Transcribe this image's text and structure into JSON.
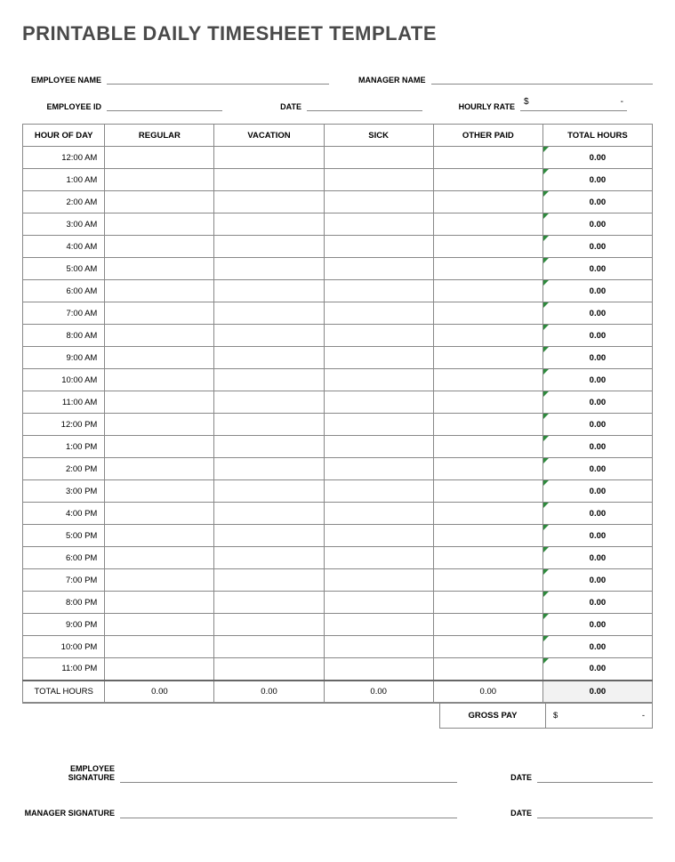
{
  "title": "PRINTABLE DAILY TIMESHEET TEMPLATE",
  "meta": {
    "employee_name_label": "EMPLOYEE NAME",
    "employee_name_value": "",
    "manager_name_label": "MANAGER NAME",
    "manager_name_value": "",
    "employee_id_label": "EMPLOYEE ID",
    "employee_id_value": "",
    "date_label": "DATE",
    "date_value": "",
    "hourly_rate_label": "HOURLY RATE",
    "hourly_rate_currency": "$",
    "hourly_rate_value": "-"
  },
  "columns": {
    "hour": "HOUR OF DAY",
    "regular": "REGULAR",
    "vacation": "VACATION",
    "sick": "SICK",
    "other": "OTHER PAID",
    "total": "TOTAL HOURS"
  },
  "rows": [
    {
      "hour": "12:00 AM",
      "regular": "",
      "vacation": "",
      "sick": "",
      "other": "",
      "total": "0.00"
    },
    {
      "hour": "1:00 AM",
      "regular": "",
      "vacation": "",
      "sick": "",
      "other": "",
      "total": "0.00"
    },
    {
      "hour": "2:00 AM",
      "regular": "",
      "vacation": "",
      "sick": "",
      "other": "",
      "total": "0.00"
    },
    {
      "hour": "3:00 AM",
      "regular": "",
      "vacation": "",
      "sick": "",
      "other": "",
      "total": "0.00"
    },
    {
      "hour": "4:00 AM",
      "regular": "",
      "vacation": "",
      "sick": "",
      "other": "",
      "total": "0.00"
    },
    {
      "hour": "5:00 AM",
      "regular": "",
      "vacation": "",
      "sick": "",
      "other": "",
      "total": "0.00"
    },
    {
      "hour": "6:00 AM",
      "regular": "",
      "vacation": "",
      "sick": "",
      "other": "",
      "total": "0.00"
    },
    {
      "hour": "7:00 AM",
      "regular": "",
      "vacation": "",
      "sick": "",
      "other": "",
      "total": "0.00"
    },
    {
      "hour": "8:00 AM",
      "regular": "",
      "vacation": "",
      "sick": "",
      "other": "",
      "total": "0.00"
    },
    {
      "hour": "9:00 AM",
      "regular": "",
      "vacation": "",
      "sick": "",
      "other": "",
      "total": "0.00"
    },
    {
      "hour": "10:00 AM",
      "regular": "",
      "vacation": "",
      "sick": "",
      "other": "",
      "total": "0.00"
    },
    {
      "hour": "11:00 AM",
      "regular": "",
      "vacation": "",
      "sick": "",
      "other": "",
      "total": "0.00"
    },
    {
      "hour": "12:00 PM",
      "regular": "",
      "vacation": "",
      "sick": "",
      "other": "",
      "total": "0.00"
    },
    {
      "hour": "1:00 PM",
      "regular": "",
      "vacation": "",
      "sick": "",
      "other": "",
      "total": "0.00"
    },
    {
      "hour": "2:00 PM",
      "regular": "",
      "vacation": "",
      "sick": "",
      "other": "",
      "total": "0.00"
    },
    {
      "hour": "3:00 PM",
      "regular": "",
      "vacation": "",
      "sick": "",
      "other": "",
      "total": "0.00"
    },
    {
      "hour": "4:00 PM",
      "regular": "",
      "vacation": "",
      "sick": "",
      "other": "",
      "total": "0.00"
    },
    {
      "hour": "5:00 PM",
      "regular": "",
      "vacation": "",
      "sick": "",
      "other": "",
      "total": "0.00"
    },
    {
      "hour": "6:00 PM",
      "regular": "",
      "vacation": "",
      "sick": "",
      "other": "",
      "total": "0.00"
    },
    {
      "hour": "7:00 PM",
      "regular": "",
      "vacation": "",
      "sick": "",
      "other": "",
      "total": "0.00"
    },
    {
      "hour": "8:00 PM",
      "regular": "",
      "vacation": "",
      "sick": "",
      "other": "",
      "total": "0.00"
    },
    {
      "hour": "9:00 PM",
      "regular": "",
      "vacation": "",
      "sick": "",
      "other": "",
      "total": "0.00"
    },
    {
      "hour": "10:00 PM",
      "regular": "",
      "vacation": "",
      "sick": "",
      "other": "",
      "total": "0.00"
    },
    {
      "hour": "11:00 PM",
      "regular": "",
      "vacation": "",
      "sick": "",
      "other": "",
      "total": "0.00"
    }
  ],
  "totals": {
    "label": "TOTAL HOURS",
    "regular": "0.00",
    "vacation": "0.00",
    "sick": "0.00",
    "other": "0.00",
    "total": "0.00"
  },
  "gross": {
    "label": "GROSS PAY",
    "currency": "$",
    "value": "-"
  },
  "signatures": {
    "employee_label": "EMPLOYEE SIGNATURE",
    "employee_date_label": "DATE",
    "manager_label": "MANAGER SIGNATURE",
    "manager_date_label": "DATE"
  }
}
